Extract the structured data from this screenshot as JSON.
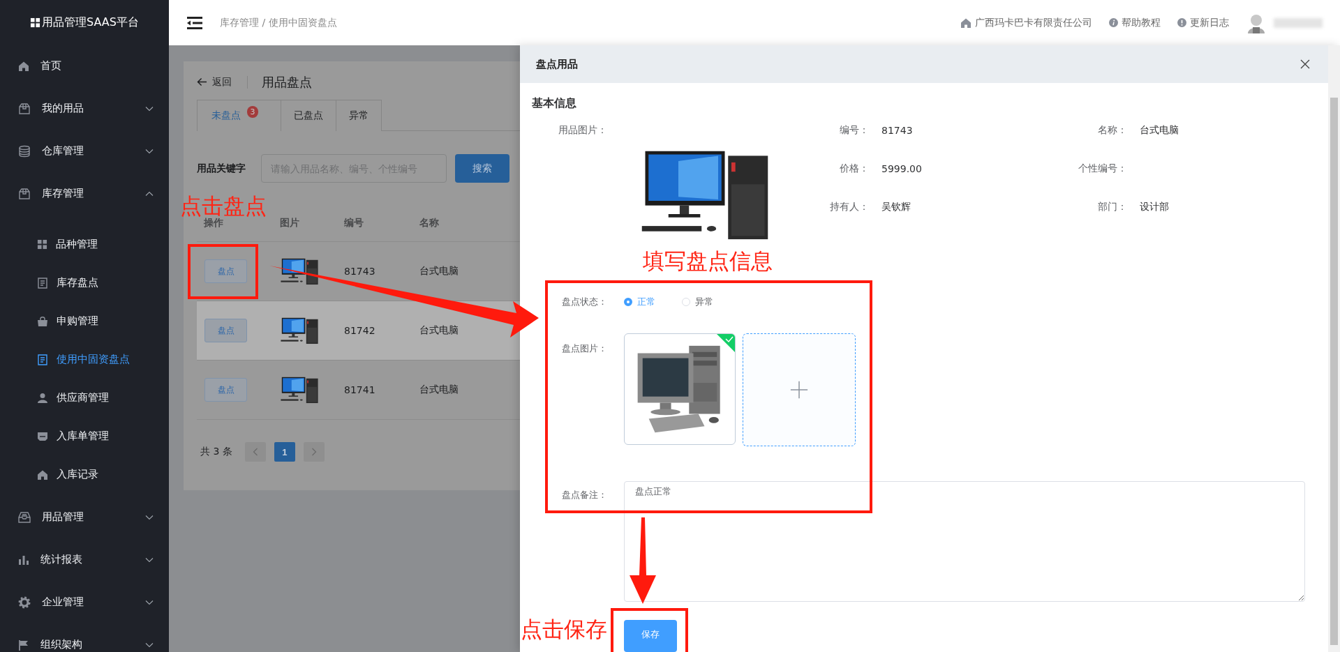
{
  "sidebar": {
    "logo": "用品管理SAAS平台",
    "items": [
      {
        "label": "首页",
        "kind": "link",
        "selected": false
      },
      {
        "label": "我的用品",
        "kind": "group",
        "expanded": false,
        "selected": false
      },
      {
        "label": "仓库管理",
        "kind": "group",
        "expanded": false,
        "selected": false
      },
      {
        "label": "库存管理",
        "kind": "group",
        "expanded": true,
        "selected": false,
        "children": [
          {
            "label": "品种管理",
            "selected": false
          },
          {
            "label": "库存盘点",
            "selected": false
          },
          {
            "label": "申购管理",
            "selected": false
          },
          {
            "label": "使用中固资盘点",
            "selected": true
          },
          {
            "label": "供应商管理",
            "selected": false
          },
          {
            "label": "入库单管理",
            "selected": false
          },
          {
            "label": "入库记录",
            "selected": false
          }
        ]
      },
      {
        "label": "用品管理",
        "kind": "group",
        "expanded": false,
        "selected": false
      },
      {
        "label": "统计报表",
        "kind": "group",
        "expanded": false,
        "selected": false
      },
      {
        "label": "企业管理",
        "kind": "group",
        "expanded": false,
        "selected": false
      },
      {
        "label": "组织架构",
        "kind": "group",
        "expanded": false,
        "selected": false
      }
    ]
  },
  "topbar": {
    "breadcrumb": "库存管理 / 使用中固资盘点",
    "links": [
      {
        "label": "广西玛卡巴卡有限责任公司"
      },
      {
        "label": "帮助教程"
      },
      {
        "label": "更新日志"
      }
    ]
  },
  "page": {
    "back": "返回",
    "title": "用品盘点",
    "tabs": [
      {
        "label": "未盘点",
        "selected": true,
        "badge": "3"
      },
      {
        "label": "已盘点",
        "selected": false
      },
      {
        "label": "异常",
        "selected": false
      }
    ],
    "search": {
      "label": "用品关键字",
      "placeholder": "请输入用品名称、编号、个性编号",
      "button": "搜索"
    },
    "table": {
      "columns": [
        "操作",
        "图片",
        "编号",
        "名称"
      ],
      "rows": [
        {
          "action": "盘点",
          "number": "81743",
          "name": "台式电脑",
          "hovered": false
        },
        {
          "action": "盘点",
          "number": "81742",
          "name": "台式电脑",
          "hovered": true
        },
        {
          "action": "盘点",
          "number": "81741",
          "name": "台式电脑",
          "hovered": false
        }
      ]
    },
    "pagination": {
      "total": "共 3 条",
      "pages": [
        {
          "label": "1",
          "selected": true
        }
      ]
    }
  },
  "drawer": {
    "title": "盘点用品",
    "section": "基本信息",
    "photo_label": "用品图片：",
    "fields": [
      {
        "label": "编号：",
        "value": "81743"
      },
      {
        "label": "名称：",
        "value": "台式电脑"
      },
      {
        "label": "价格：",
        "value": "5999.00"
      },
      {
        "label": "个性编号："
      },
      {
        "label": "持有人：",
        "value": "吴钦辉"
      },
      {
        "label": "部门：",
        "value": "设计部"
      }
    ],
    "form": {
      "status": {
        "label": "盘点状态：",
        "options": [
          {
            "label": "正常",
            "selected": true
          },
          {
            "label": "异常",
            "selected": false
          }
        ]
      },
      "photos": {
        "label": "盘点图片：",
        "items": [
          {
            "uploaded": true
          }
        ]
      },
      "remark": {
        "label": "盘点备注：",
        "value": "盘点正常"
      },
      "save": "保存"
    }
  },
  "annotations": [
    "点击盘点",
    "填写盘点信息",
    "点击保存"
  ]
}
